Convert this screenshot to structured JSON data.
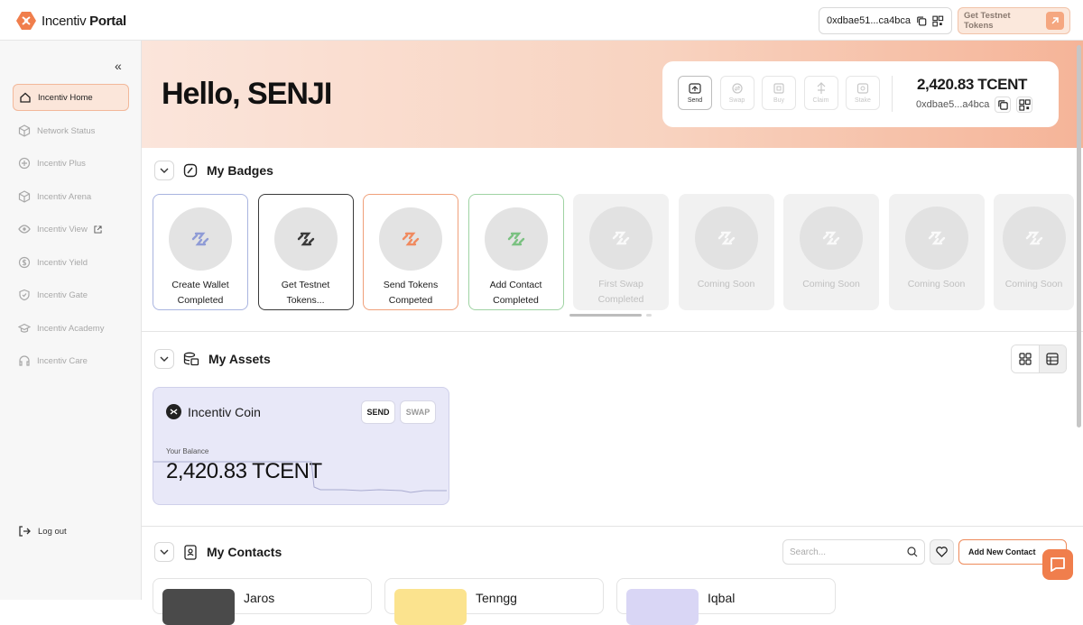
{
  "app": {
    "brand_prefix": "Incentiv",
    "brand_suffix": "Portal"
  },
  "topbar": {
    "address": "0xdbae51...ca4bca",
    "testnet_label": "Get Testnet Tokens"
  },
  "sidebar": {
    "items": [
      {
        "label": "Incentiv Home",
        "icon": "home-icon",
        "active": true
      },
      {
        "label": "Network Status",
        "icon": "cube-icon"
      },
      {
        "label": "Incentiv Plus",
        "icon": "plus-circle-icon"
      },
      {
        "label": "Incentiv Arena",
        "icon": "cube-icon"
      },
      {
        "label": "Incentiv View",
        "icon": "eye-icon"
      },
      {
        "label": "Incentiv Yield",
        "icon": "dollar-icon"
      },
      {
        "label": "Incentiv Gate",
        "icon": "shield-icon"
      },
      {
        "label": "Incentiv Academy",
        "icon": "cap-icon"
      },
      {
        "label": "Incentiv Care",
        "icon": "headset-icon"
      }
    ],
    "logout": "Log out"
  },
  "hero": {
    "greeting": "Hello, SENJI",
    "actions": [
      "Send",
      "Swap",
      "Buy",
      "Claim",
      "Stake"
    ],
    "balance": "2,420.83 TCENT",
    "address": "0xdbae5...a4bca"
  },
  "badges": {
    "title": "My Badges",
    "items": [
      {
        "line1": "Create Wallet",
        "line2": "Completed",
        "color": "#a9b4e0"
      },
      {
        "line1": "Get Testnet",
        "line2": "Tokens...",
        "color": "#3a3a3a"
      },
      {
        "line1": "Send Tokens",
        "line2": "Competed",
        "color": "#f0a07a"
      },
      {
        "line1": "Add Contact",
        "line2": "Completed",
        "color": "#9fd3a3"
      },
      {
        "line1": "First Swap",
        "line2": "Completed"
      },
      {
        "line1": "Coming Soon",
        "line2": ""
      },
      {
        "line1": "Coming Soon",
        "line2": ""
      },
      {
        "line1": "Coming Soon",
        "line2": ""
      },
      {
        "line1": "Coming Soon",
        "line2": ""
      }
    ]
  },
  "assets": {
    "title": "My Assets",
    "coin": {
      "name": "Incentiv Coin",
      "send": "SEND",
      "swap": "SWAP",
      "balance_label": "Your Balance",
      "balance": "2,420.83 TCENT"
    }
  },
  "contacts": {
    "title": "My Contacts",
    "search_placeholder": "Search...",
    "add_label": "Add New Contact",
    "items": [
      {
        "name": "Jaros",
        "color": "#4a4a4a"
      },
      {
        "name": "Tenngg",
        "color": "#fbe38e"
      },
      {
        "name": "Iqbal",
        "color": "#d9d6f5"
      }
    ]
  },
  "colors": {
    "accent": "#f07e4c",
    "hero_start": "#fbe5db",
    "hero_end": "#f5b498"
  }
}
